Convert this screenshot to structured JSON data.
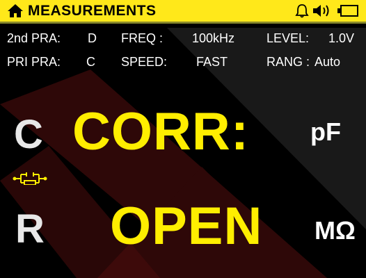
{
  "header": {
    "title": "MEASUREMENTS",
    "home_icon": "home-icon",
    "status_icons": [
      "bell-icon",
      "speaker-icon",
      "battery-icon"
    ],
    "background_color": "#ffe81a"
  },
  "params": {
    "second_param": {
      "label": "2nd PRA:",
      "value": "D"
    },
    "freq": {
      "label": "FREQ  :",
      "value": "100kHz"
    },
    "level": {
      "label": "LEVEL:",
      "value": "1.0V"
    },
    "primary_param": {
      "label": "PRI PRA:",
      "value": "C"
    },
    "speed": {
      "label": "SPEED:",
      "value": "FAST"
    },
    "range": {
      "label": "RANG :",
      "value": "Auto"
    }
  },
  "primary": {
    "symbol": "C",
    "value": "CORR:",
    "unit": "pF"
  },
  "secondary": {
    "symbol": "R",
    "value": "OPEN",
    "unit": "MΩ"
  },
  "circuit_mode_icon": "parallel-equivalent-circuit-icon",
  "colors": {
    "accent_yellow": "#ffee00",
    "background": "#000000",
    "watermark": "#3a0a0a"
  }
}
